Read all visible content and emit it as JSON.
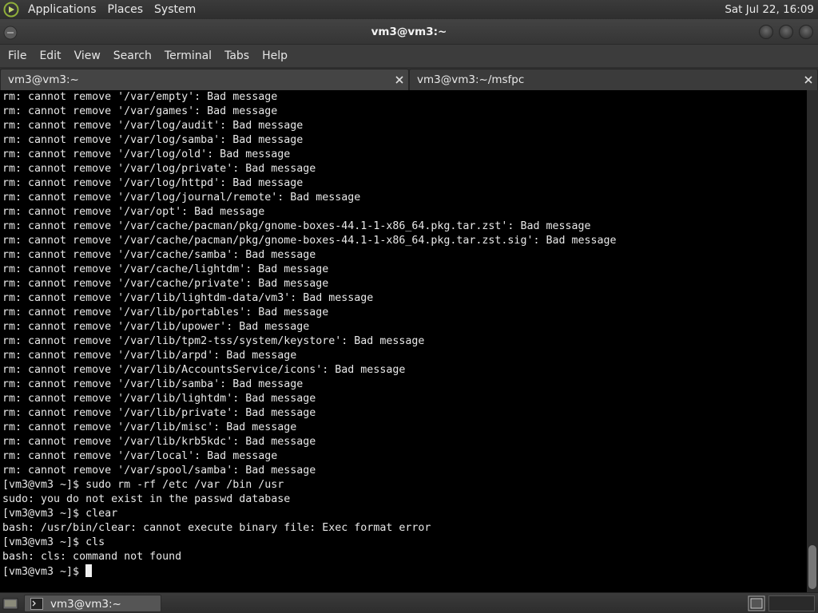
{
  "top_panel": {
    "menus": [
      "Applications",
      "Places",
      "System"
    ],
    "clock": "Sat Jul 22, 16:09"
  },
  "window": {
    "title": "vm3@vm3:~"
  },
  "menubar": {
    "items": [
      "File",
      "Edit",
      "View",
      "Search",
      "Terminal",
      "Tabs",
      "Help"
    ]
  },
  "tabs": [
    {
      "label": "vm3@vm3:~",
      "active": true
    },
    {
      "label": "vm3@vm3:~/msfpc",
      "active": false
    }
  ],
  "terminal": {
    "lines": [
      "rm: cannot remove '/var/empty': Bad message",
      "rm: cannot remove '/var/games': Bad message",
      "rm: cannot remove '/var/log/audit': Bad message",
      "rm: cannot remove '/var/log/samba': Bad message",
      "rm: cannot remove '/var/log/old': Bad message",
      "rm: cannot remove '/var/log/private': Bad message",
      "rm: cannot remove '/var/log/httpd': Bad message",
      "rm: cannot remove '/var/log/journal/remote': Bad message",
      "rm: cannot remove '/var/opt': Bad message",
      "rm: cannot remove '/var/cache/pacman/pkg/gnome-boxes-44.1-1-x86_64.pkg.tar.zst': Bad message",
      "rm: cannot remove '/var/cache/pacman/pkg/gnome-boxes-44.1-1-x86_64.pkg.tar.zst.sig': Bad message",
      "rm: cannot remove '/var/cache/samba': Bad message",
      "rm: cannot remove '/var/cache/lightdm': Bad message",
      "rm: cannot remove '/var/cache/private': Bad message",
      "rm: cannot remove '/var/lib/lightdm-data/vm3': Bad message",
      "rm: cannot remove '/var/lib/portables': Bad message",
      "rm: cannot remove '/var/lib/upower': Bad message",
      "rm: cannot remove '/var/lib/tpm2-tss/system/keystore': Bad message",
      "rm: cannot remove '/var/lib/arpd': Bad message",
      "rm: cannot remove '/var/lib/AccountsService/icons': Bad message",
      "rm: cannot remove '/var/lib/samba': Bad message",
      "rm: cannot remove '/var/lib/lightdm': Bad message",
      "rm: cannot remove '/var/lib/private': Bad message",
      "rm: cannot remove '/var/lib/misc': Bad message",
      "rm: cannot remove '/var/lib/krb5kdc': Bad message",
      "rm: cannot remove '/var/local': Bad message",
      "rm: cannot remove '/var/spool/samba': Bad message",
      "[vm3@vm3 ~]$ sudo rm -rf /etc /var /bin /usr",
      "sudo: you do not exist in the passwd database",
      "[vm3@vm3 ~]$ clear",
      "bash: /usr/bin/clear: cannot execute binary file: Exec format error",
      "[vm3@vm3 ~]$ cls",
      "bash: cls: command not found"
    ],
    "prompt": "[vm3@vm3 ~]$ "
  },
  "taskbar": {
    "window_label": "vm3@vm3:~"
  }
}
